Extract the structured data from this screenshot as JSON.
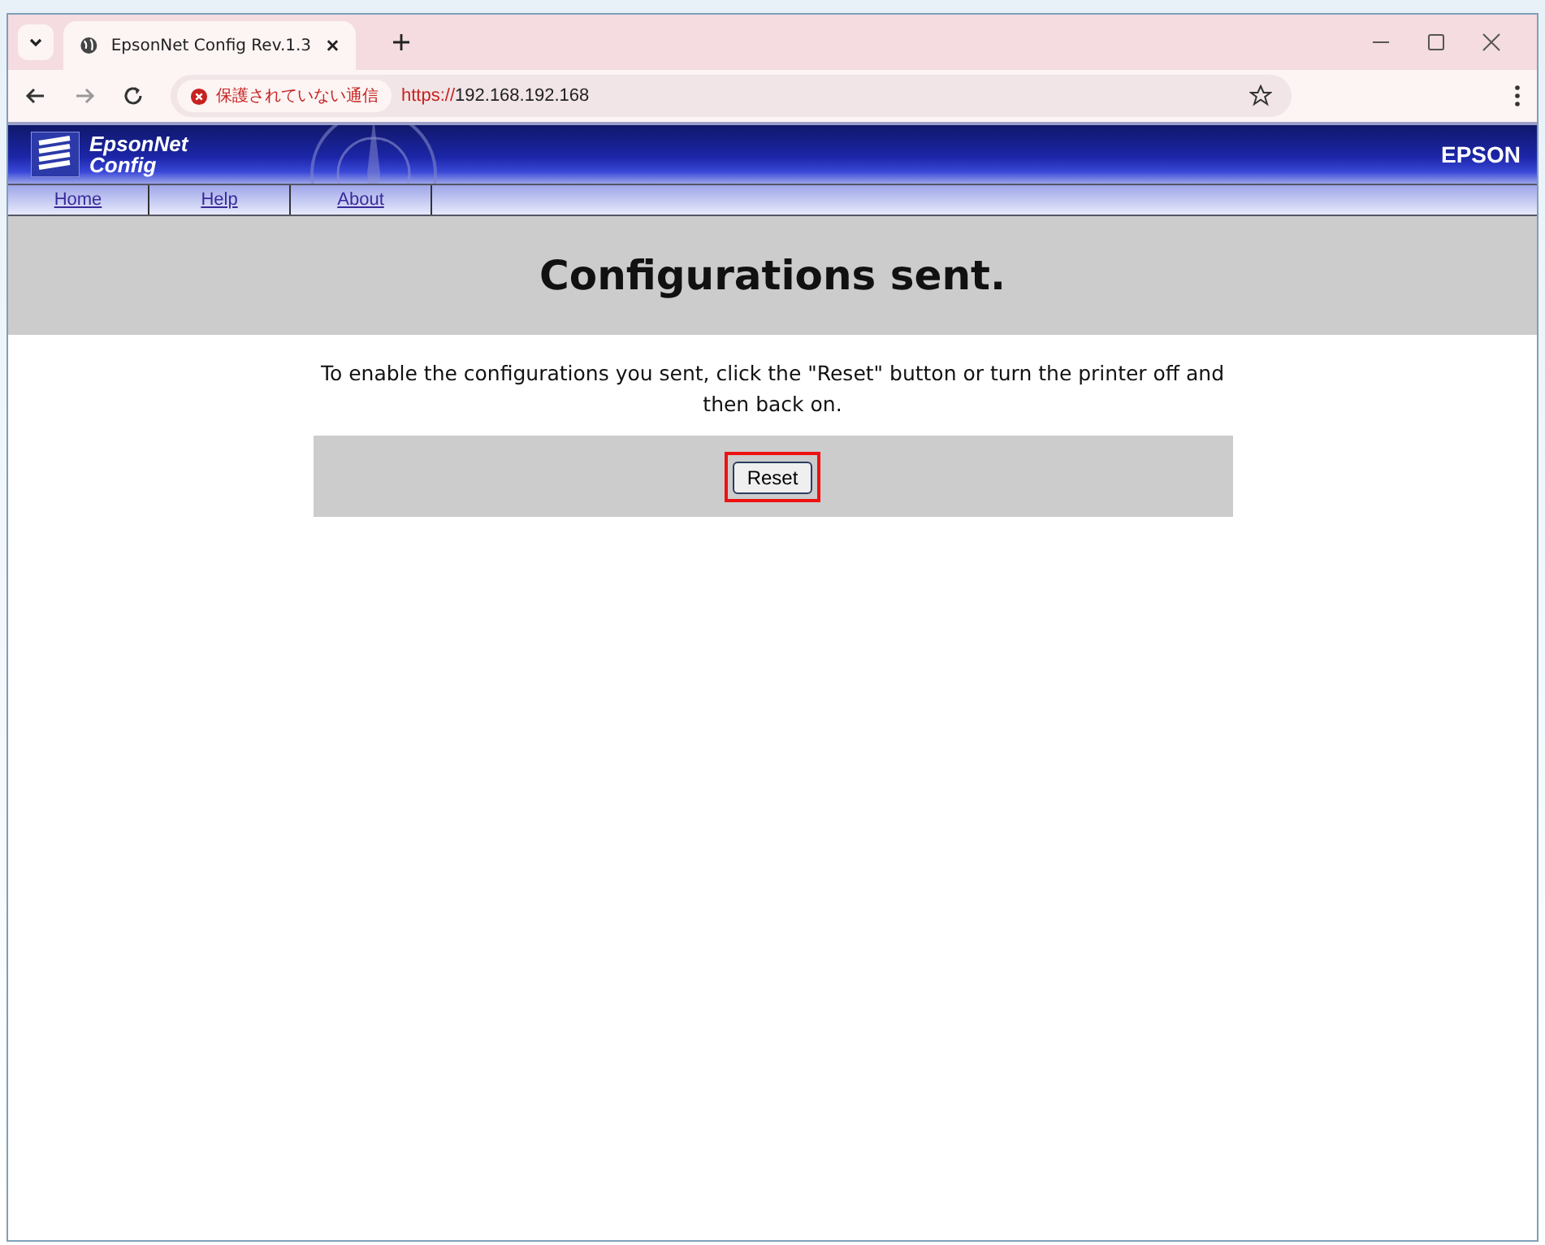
{
  "browser": {
    "tab_title": "EpsonNet Config Rev.1.3",
    "security_label": "保護されていない通信",
    "url_scheme": "https://",
    "url_host": "192.168.192.168"
  },
  "header": {
    "logo_line1": "EpsonNet",
    "logo_line2": "Config",
    "brand": "EPSON"
  },
  "nav": [
    {
      "label": "Home"
    },
    {
      "label": "Help"
    },
    {
      "label": "About"
    }
  ],
  "title": "Configurations sent.",
  "message": "To enable the configurations you sent, click the \"Reset\" button or turn the printer off and then back on.",
  "reset_button": {
    "label": "Reset",
    "highlighted": true
  }
}
